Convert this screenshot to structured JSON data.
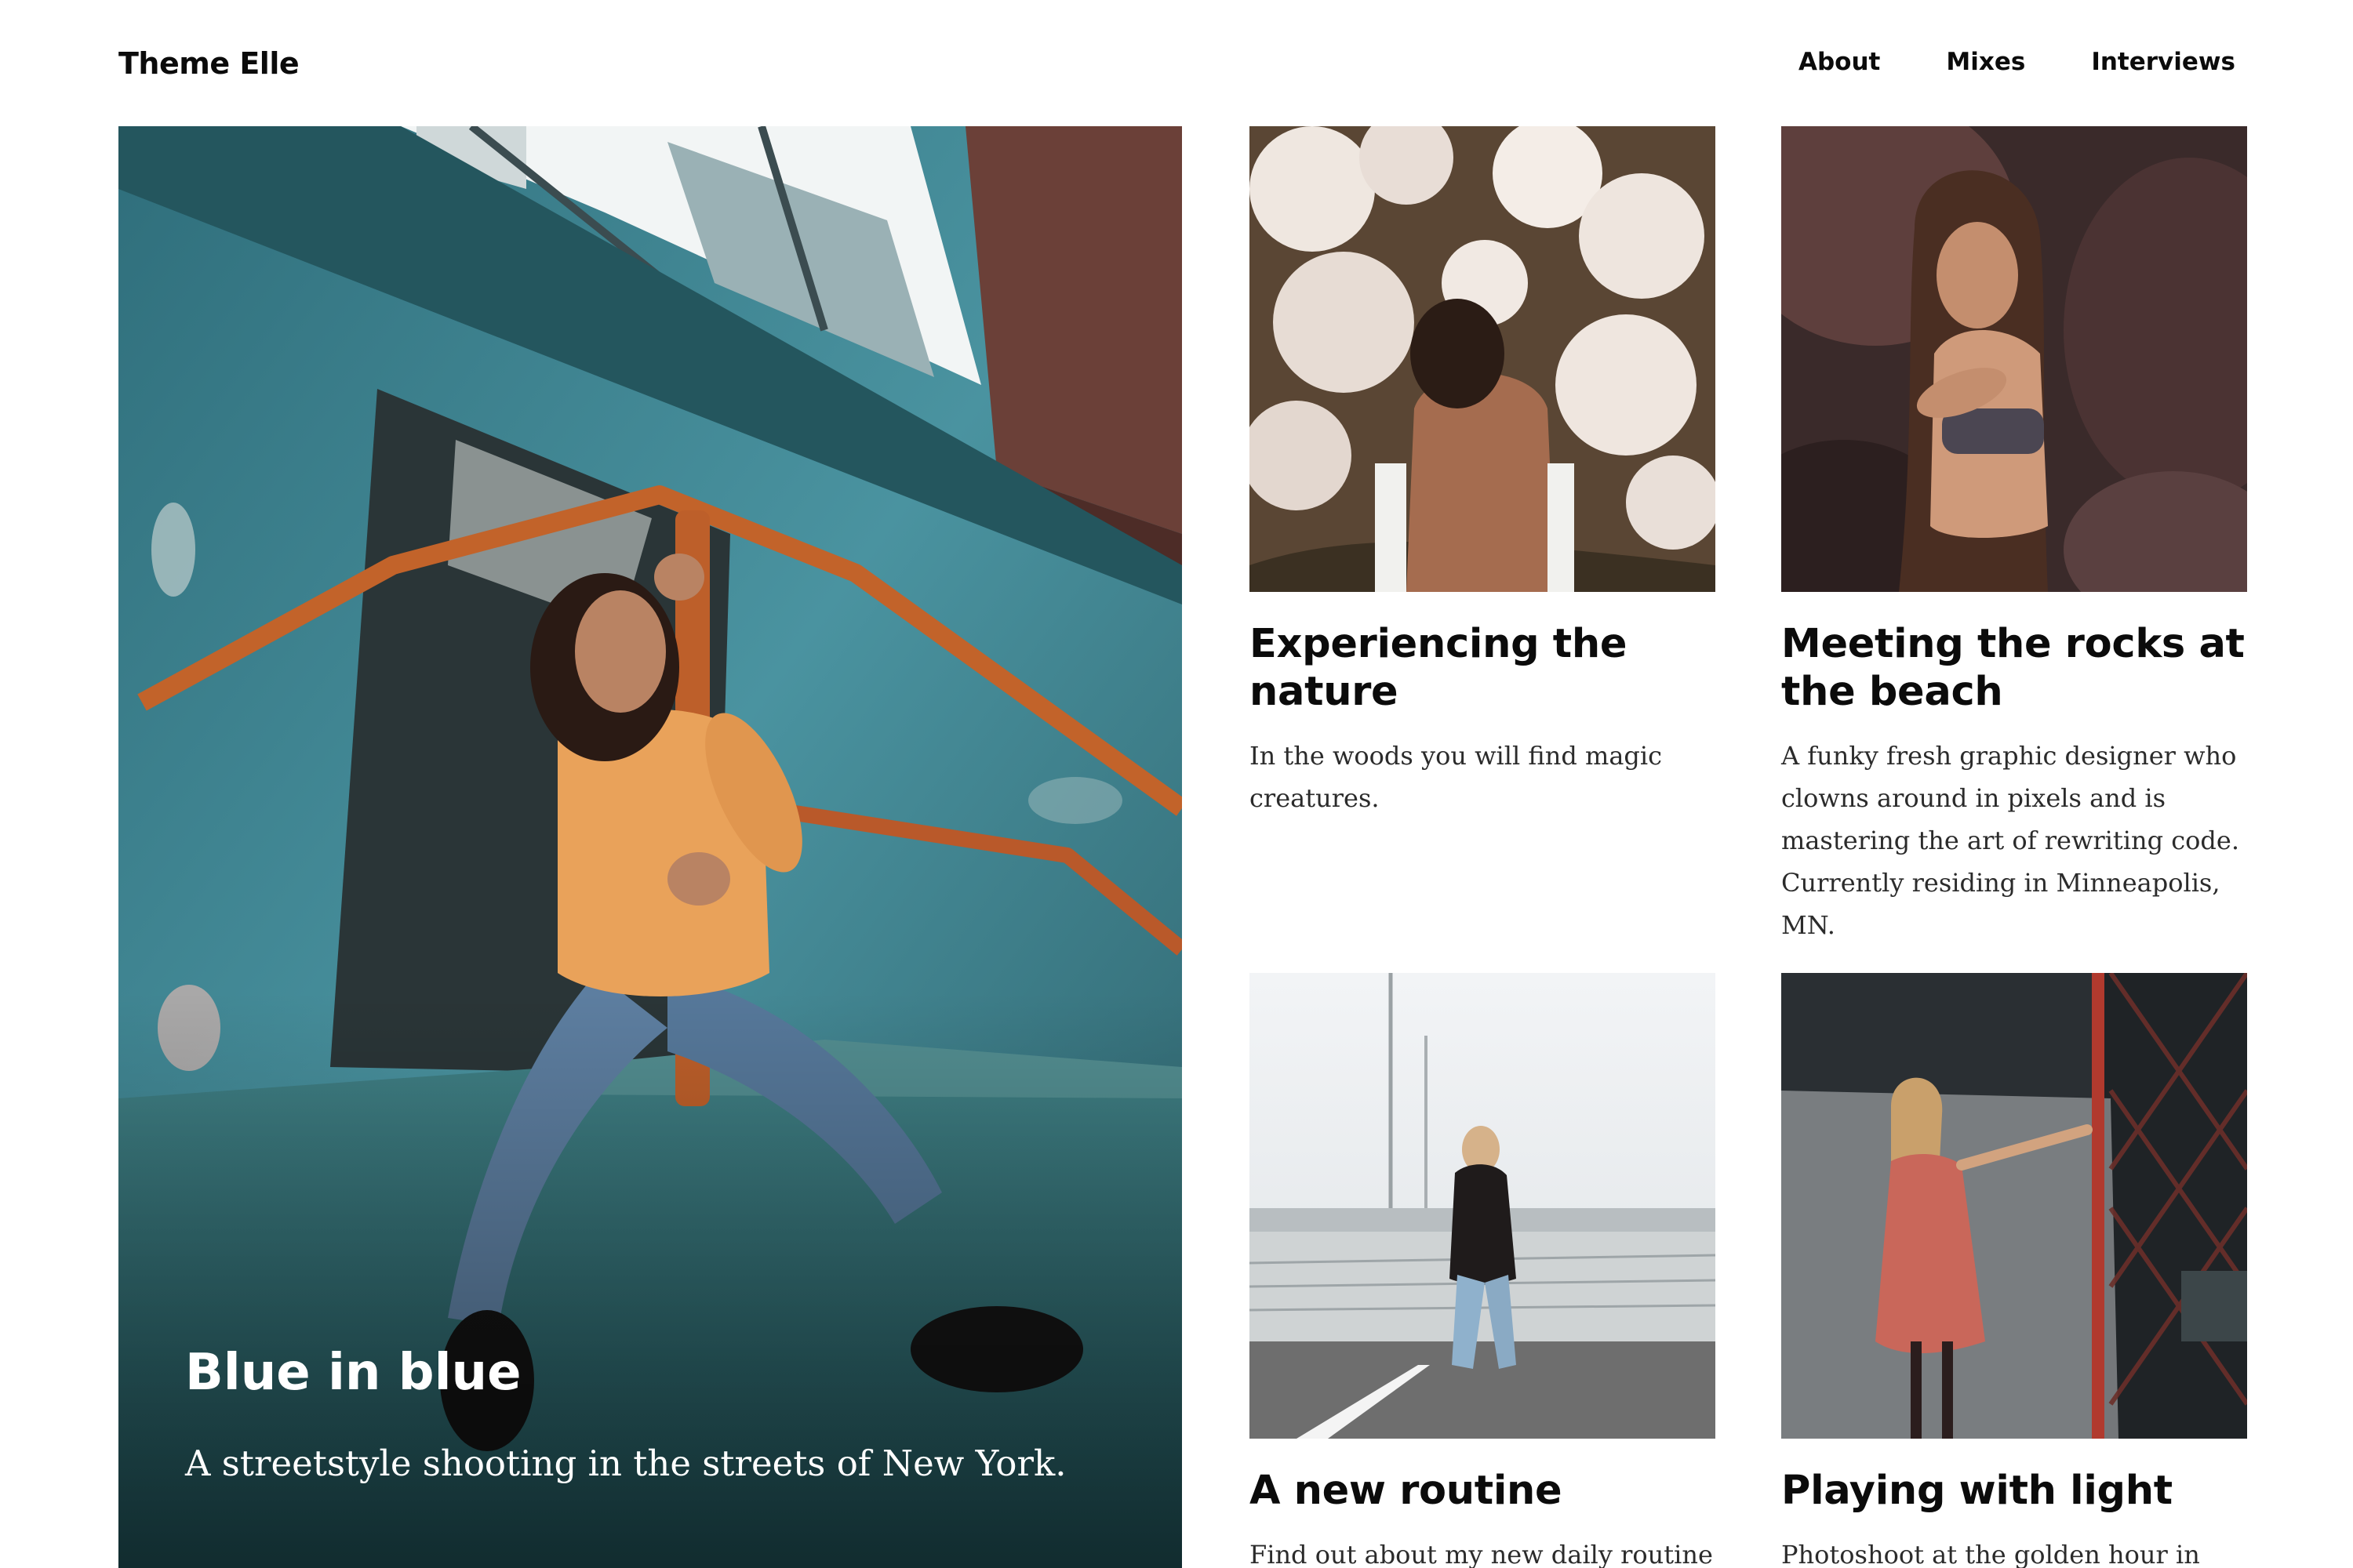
{
  "header": {
    "brand": "Theme Elle",
    "nav": [
      "About",
      "Mixes",
      "Interviews"
    ]
  },
  "featured": {
    "title": "Blue in blue",
    "description": "A streetstyle shooting in the streets of New York."
  },
  "cards": [
    {
      "title": "Experiencing the nature",
      "description": "In the woods you will find magic creatures."
    },
    {
      "title": "Meeting the rocks at the beach",
      "description": "A funky fresh graphic designer who clowns around in pixels and is mastering the art of rewriting code. Currently residing in Minneapolis, MN."
    },
    {
      "title": "A new routine",
      "description": "Find out about my new daily routine"
    },
    {
      "title": "Playing with light",
      "description": "Photoshoot at the golden hour in"
    }
  ],
  "colors": {
    "text": "#0b0b0b",
    "background": "#ffffff",
    "teal_wall": "#3e8593",
    "orange_rail": "#c2632a"
  }
}
